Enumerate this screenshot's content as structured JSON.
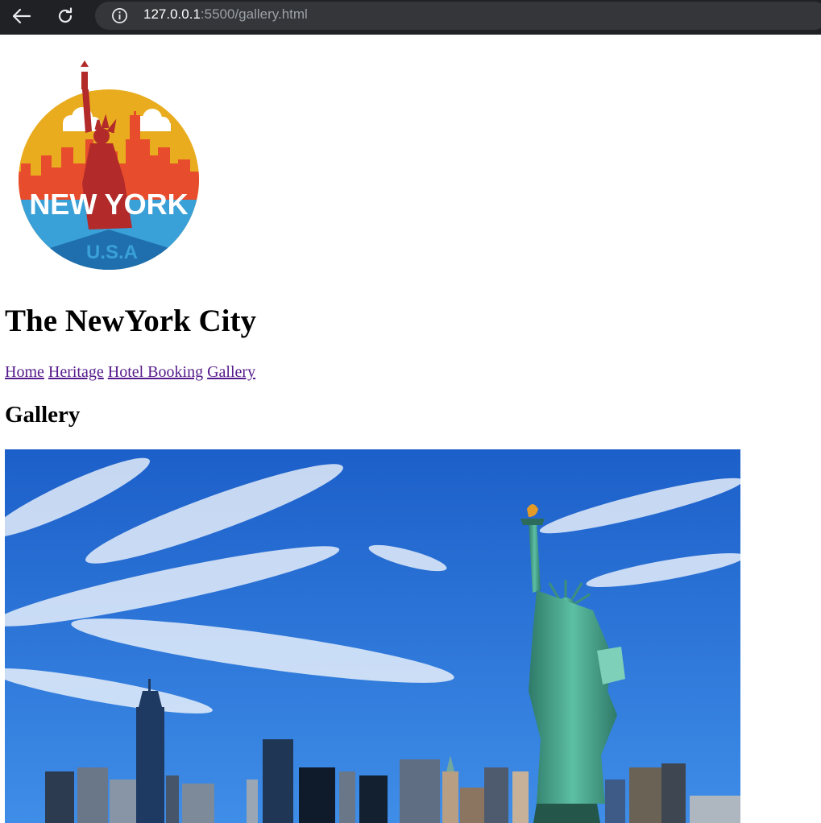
{
  "browser": {
    "url_host": "127.0.0.1",
    "url_rest": ":5500/gallery.html",
    "back_icon": "arrow-left-icon",
    "reload_icon": "reload-icon",
    "info_icon": "info-icon"
  },
  "page": {
    "logo": {
      "text_main": "NEW YORK",
      "text_sub": "U.S.A"
    },
    "title": "The NewYork City",
    "nav": [
      {
        "label": "Home"
      },
      {
        "label": "Heritage"
      },
      {
        "label": "Hotel Booking"
      },
      {
        "label": "Gallery"
      }
    ],
    "section_title": "Gallery"
  },
  "colors": {
    "link_visited": "#551a8b",
    "chrome_bg": "#202124",
    "sky_blue": "#1f6fd6",
    "statue_green": "#4fae94"
  }
}
